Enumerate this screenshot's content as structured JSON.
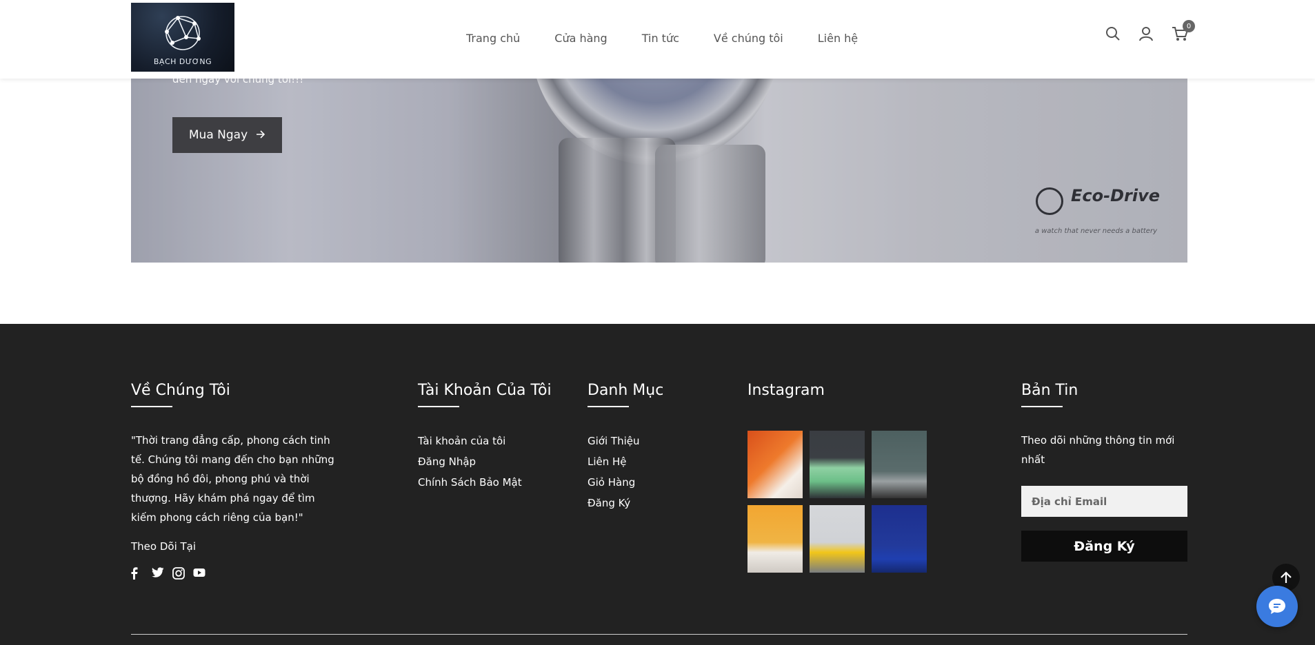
{
  "header": {
    "logo_text": "BẠCH DƯƠNG",
    "nav": [
      "Trang chủ",
      "Cửa hàng",
      "Tin tức",
      "Về chúng tôi",
      "Liên hệ"
    ],
    "cart_count": "0",
    "icons": [
      "search-icon",
      "user-icon",
      "cart-icon"
    ]
  },
  "banner": {
    "text": "đến ngay với chúng tôi!!!",
    "button_label": "Mua Ngay",
    "brand_text": "Eco-Drive",
    "brand_sub": "a watch that never needs a battery"
  },
  "footer": {
    "about": {
      "title": "Về Chúng Tôi",
      "quote": "\"Thời trang đẳng cấp, phong cách tinh tế. Chúng tôi mang đến cho bạn những bộ đồng hồ đôi, phong phú và thời thượng. Hãy khám phá ngay để tìm kiếm phong cách riêng của bạn!\"",
      "follow": "Theo Dõi Tại",
      "socials": [
        "facebook-icon",
        "twitter-icon",
        "instagram-icon",
        "youtube-icon"
      ]
    },
    "account": {
      "title": "Tài Khoản Của Tôi",
      "items": [
        "Tài khoản của tôi",
        "Đăng Nhập",
        "Chính Sách Bảo Mật"
      ]
    },
    "category": {
      "title": "Danh Mục",
      "items": [
        "Giới Thiệu",
        "Liên Hệ",
        "Giỏ Hàng",
        "Đăng Ký"
      ]
    },
    "instagram": {
      "title": "Instagram"
    },
    "newsletter": {
      "title": "Bản Tin",
      "text": "Theo dõi những thông tin mới nhất",
      "email_placeholder": "Địa chỉ Email",
      "button_label": "Đăng Ký"
    }
  }
}
